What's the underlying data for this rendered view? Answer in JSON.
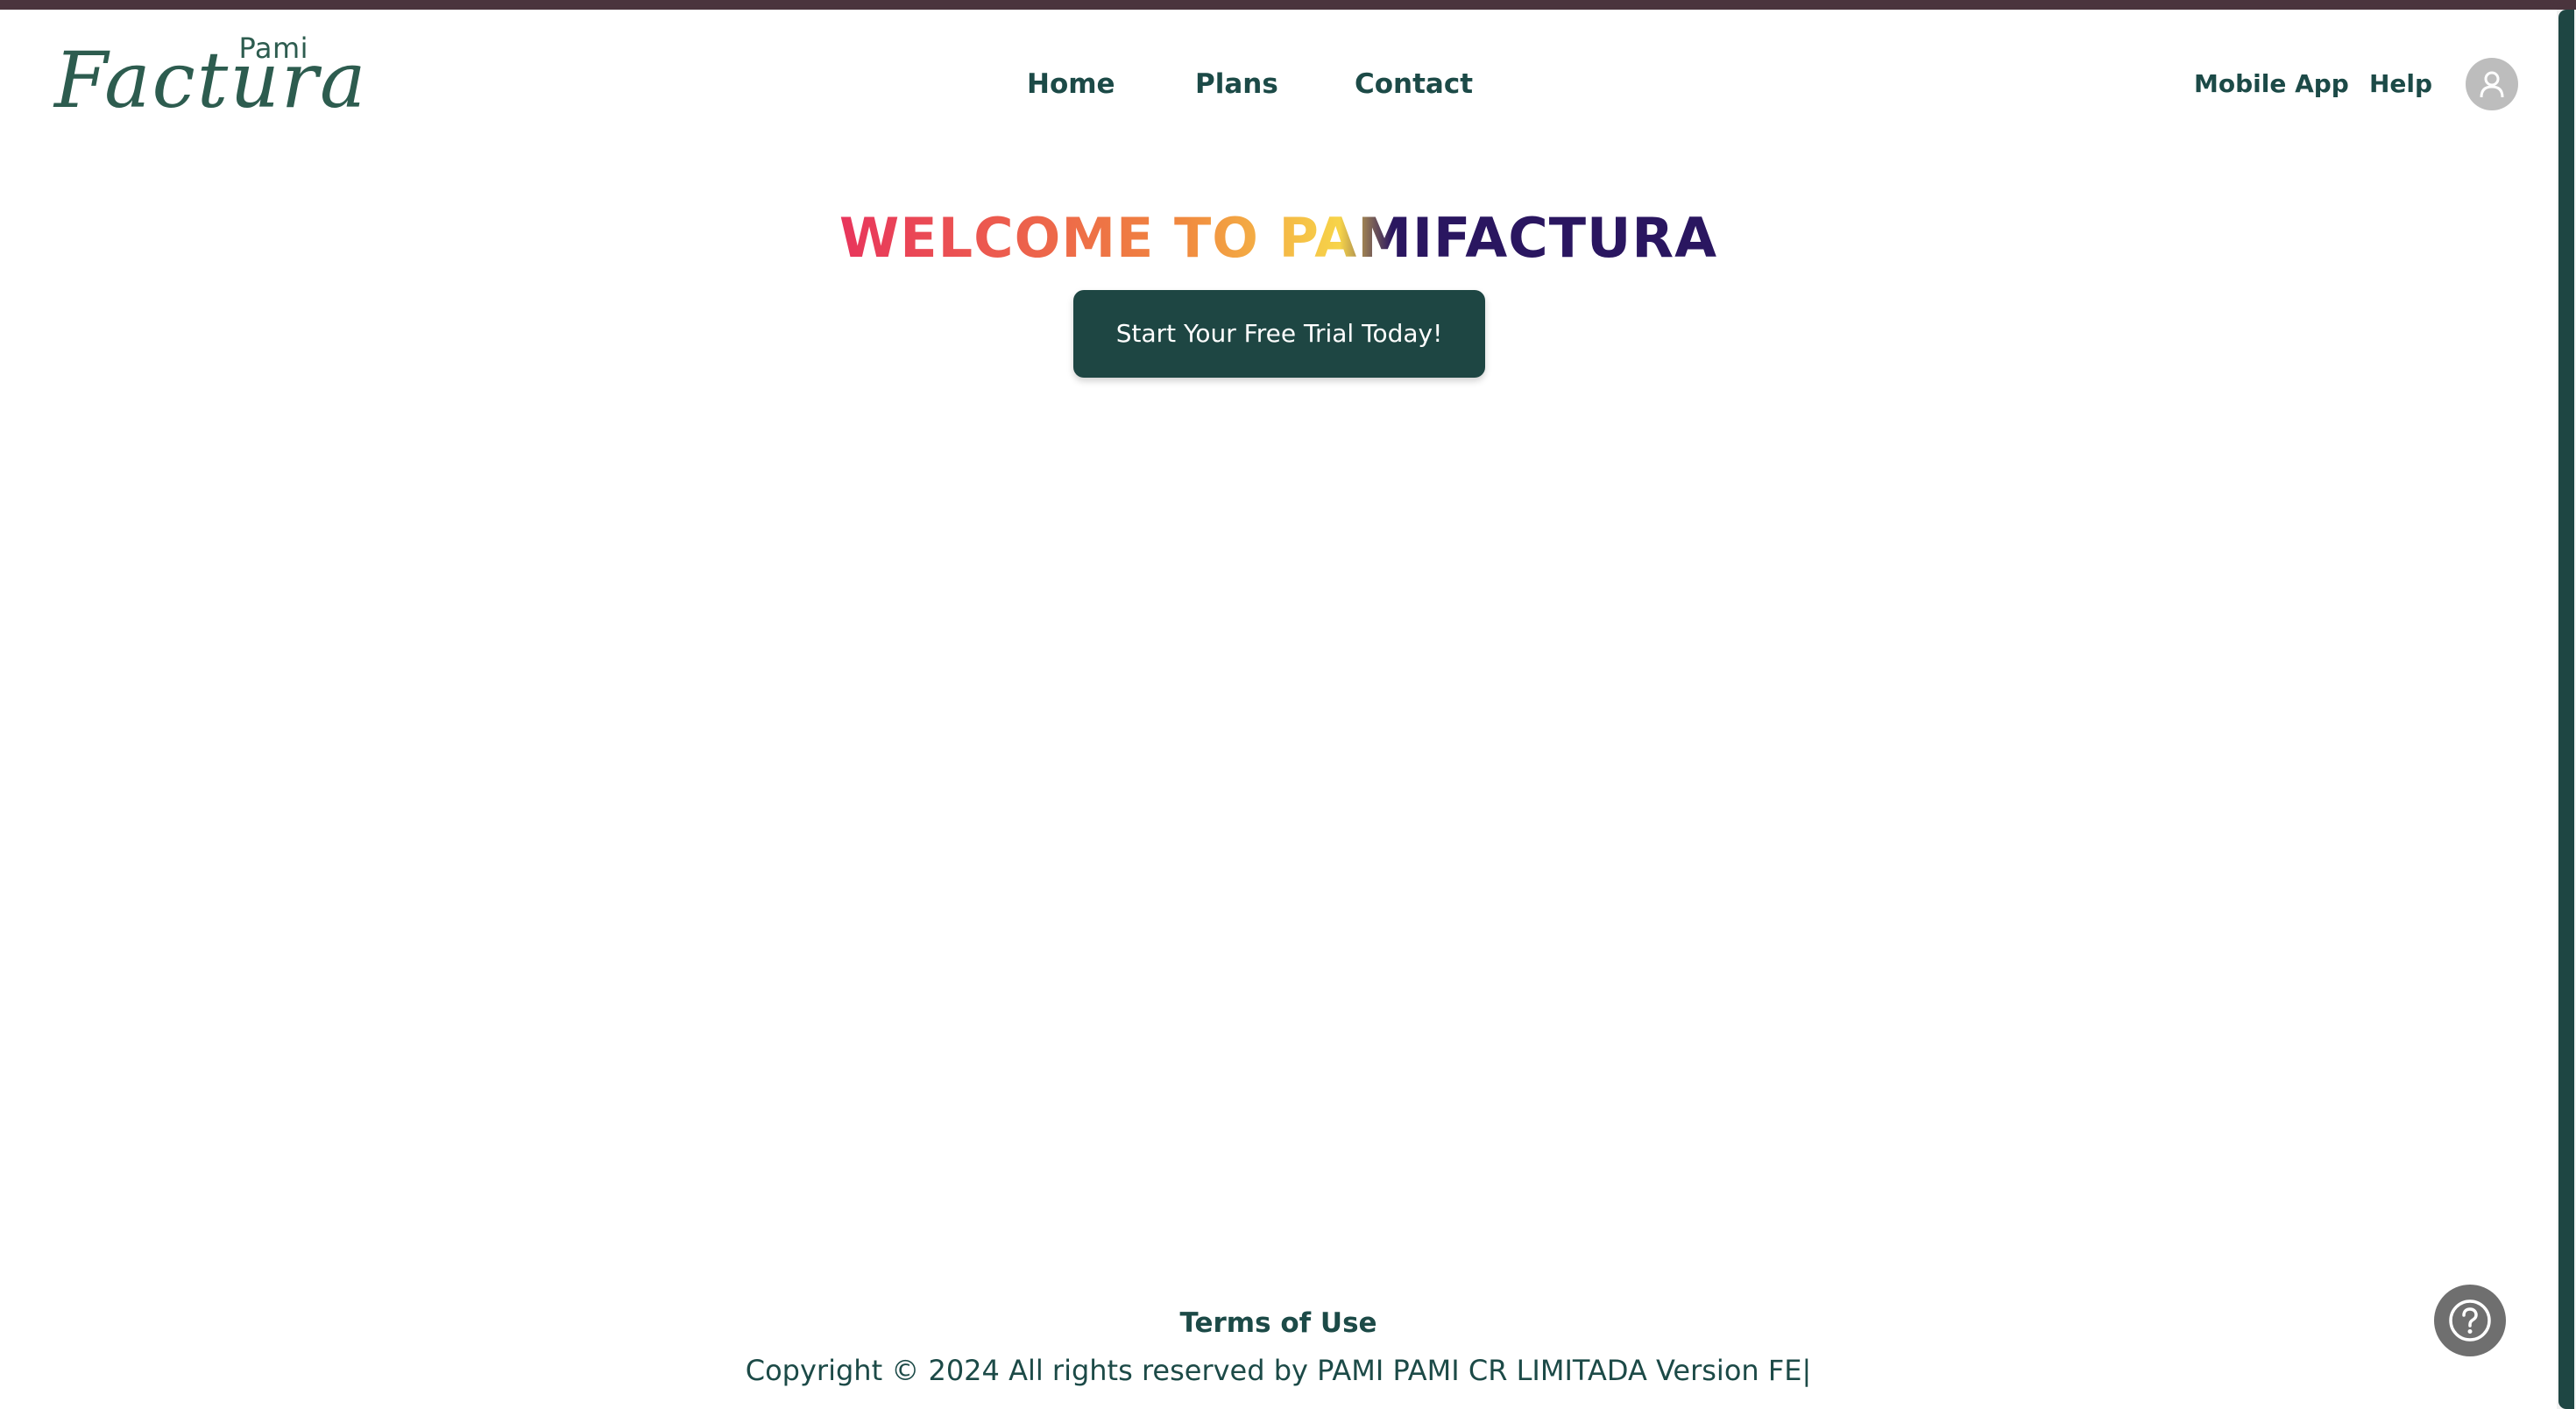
{
  "brand": {
    "logo_small": "Pami",
    "logo_script": "Factura"
  },
  "nav": {
    "home": "Home",
    "plans": "Plans",
    "contact": "Contact"
  },
  "header_right": {
    "mobile_app": "Mobile App",
    "help": "Help",
    "avatar_icon": "user-icon"
  },
  "hero": {
    "title": "WELCOME TO PAMIFACTURA",
    "cta_label": "Start Your Free Trial Today!"
  },
  "footer": {
    "terms": "Terms of Use",
    "copyright": "Copyright © 2024 All rights reserved by PAMI PAMI CR LIMITADA Version FE|"
  },
  "help_fab": {
    "icon": "question-circle-icon"
  },
  "colors": {
    "primary": "#1e4643",
    "top_strip": "#4a343d",
    "gradient": [
      "#e8355c",
      "#f0853f",
      "#f7d449",
      "#2a1660"
    ]
  }
}
